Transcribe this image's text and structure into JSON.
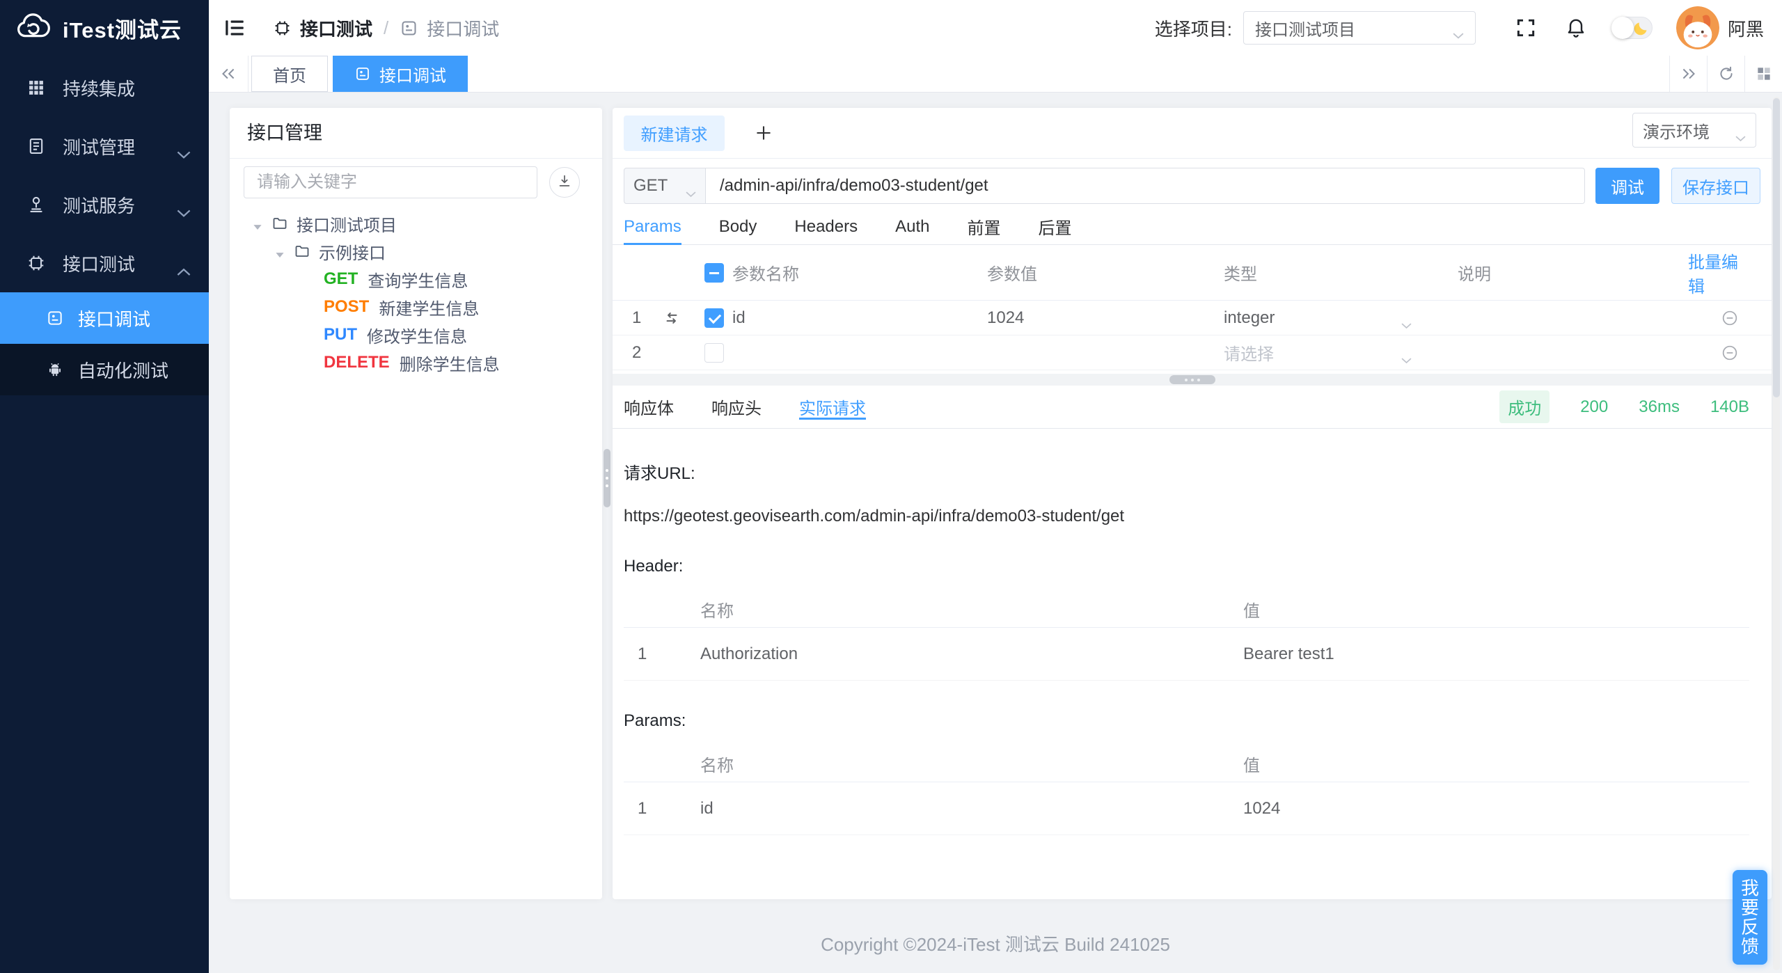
{
  "colors": {
    "accent_blue": "#409eff",
    "active_menu_blue": "#3e9cfc",
    "success_green": "#3dbd7d",
    "sidebar_bg": "#0d1c36",
    "method_get": "#23b223",
    "method_post": "#ff7d00",
    "method_put": "#2f88ff",
    "method_delete": "#f0353f"
  },
  "sidebar": {
    "logo_text": "iTest测试云",
    "items": [
      {
        "label": "持续集成"
      },
      {
        "label": "测试管理"
      },
      {
        "label": "测试服务"
      },
      {
        "label": "接口测试"
      }
    ],
    "subitems": [
      {
        "label": "接口调试"
      },
      {
        "label": "自动化测试"
      }
    ]
  },
  "header": {
    "breadcrumb_1": "接口测试",
    "breadcrumb_sep": "/",
    "breadcrumb_2": "接口调试",
    "project_label": "选择项目:",
    "project_value": "接口测试项目",
    "username": "阿黑"
  },
  "tabbar": {
    "tab_home": "首页",
    "tab_active": "接口调试"
  },
  "left_panel": {
    "title": "接口管理",
    "search_placeholder": "请输入关键字",
    "tree": {
      "root_label": "接口测试项目",
      "folder_label": "示例接口",
      "apis": [
        {
          "method": "GET",
          "label": "查询学生信息"
        },
        {
          "method": "POST",
          "label": "新建学生信息"
        },
        {
          "method": "PUT",
          "label": "修改学生信息"
        },
        {
          "method": "DELETE",
          "label": "删除学生信息"
        }
      ]
    }
  },
  "request": {
    "tab_label": "新建请求",
    "env_value": "演示环境",
    "method": "GET",
    "url": "/admin-api/infra/demo03-student/get",
    "debug_label": "调试",
    "save_label": "保存接口",
    "tabs": {
      "params": "Params",
      "body": "Body",
      "headers": "Headers",
      "auth": "Auth",
      "pre": "前置",
      "post": "后置"
    },
    "table": {
      "col_name": "参数名称",
      "col_value": "参数值",
      "col_type": "类型",
      "col_desc": "说明",
      "bulk_edit": "批量编辑",
      "rows": [
        {
          "index": "1",
          "name": "id",
          "value": "1024",
          "type": "integer"
        },
        {
          "index": "2",
          "type_placeholder": "请选择"
        }
      ]
    }
  },
  "response": {
    "tab_body": "响应体",
    "tab_headers": "响应头",
    "tab_actual": "实际请求",
    "status_badge": "成功",
    "status_code": "200",
    "duration": "36ms",
    "size": "140B",
    "url_label": "请求URL:",
    "url": "https://geotest.geovisearth.com/admin-api/infra/demo03-student/get",
    "header_label": "Header:",
    "params_label": "Params:",
    "col_name": "名称",
    "col_value": "值",
    "header_rows": [
      {
        "index": "1",
        "name": "Authorization",
        "value": "Bearer test1"
      }
    ],
    "param_rows": [
      {
        "index": "1",
        "name": "id",
        "value": "1024"
      }
    ]
  },
  "footer": {
    "copyright": "Copyright ©2024-iTest 测试云 Build 241025"
  },
  "feedback": {
    "label": "我要反馈"
  }
}
